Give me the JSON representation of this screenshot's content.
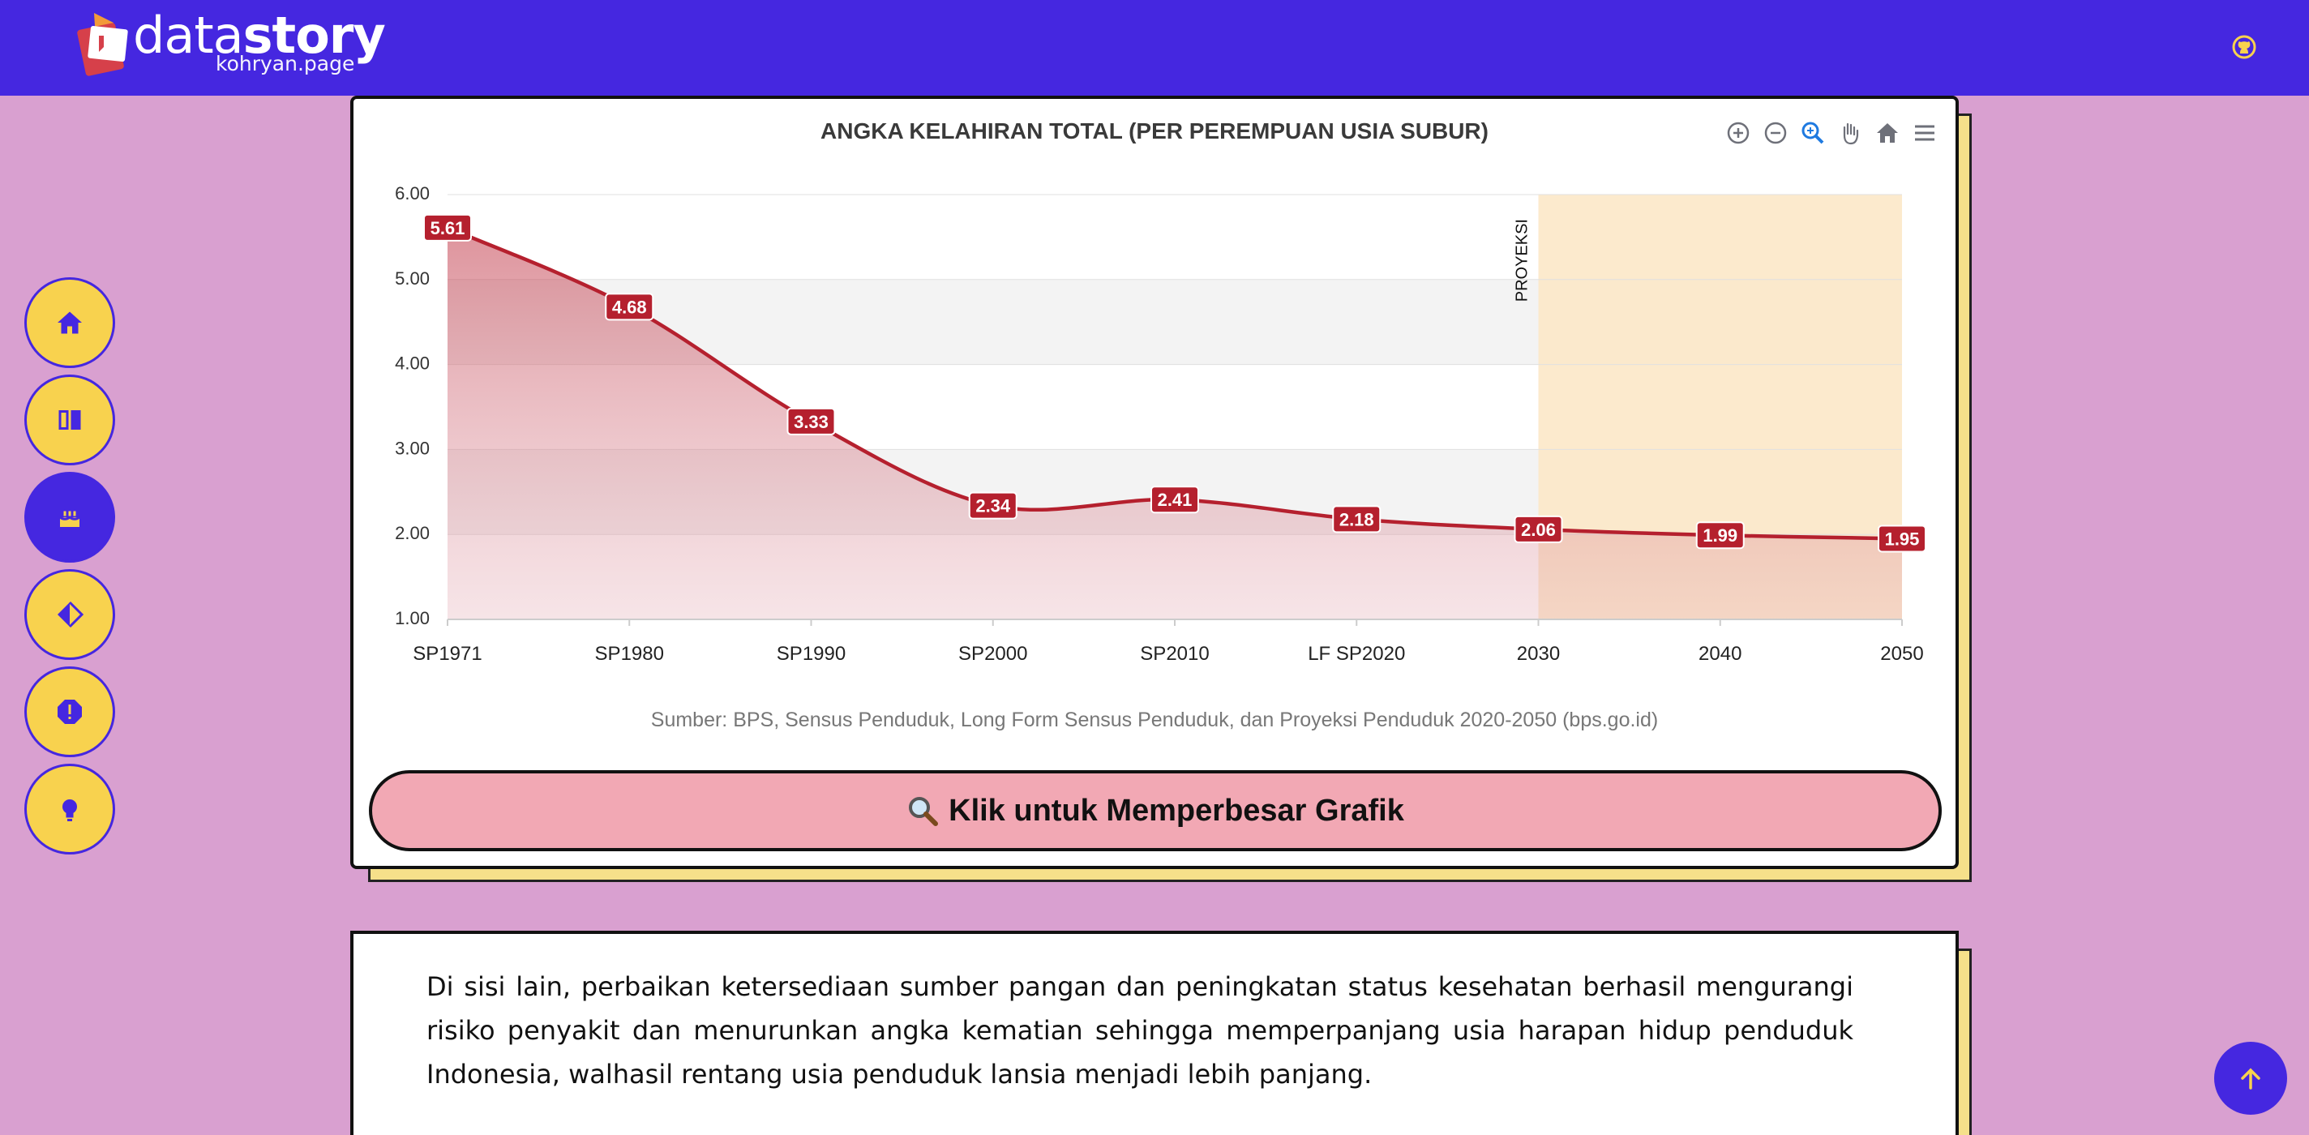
{
  "header": {
    "brand_light": "data",
    "brand_bold": "story",
    "brand_sub": "kohryan.page",
    "github_icon": "github-icon"
  },
  "side_nav": [
    {
      "icon": "home-icon",
      "active": false
    },
    {
      "icon": "book-icon",
      "active": false
    },
    {
      "icon": "birthday-cake-icon",
      "active": true
    },
    {
      "icon": "diamond-icon",
      "active": false
    },
    {
      "icon": "alert-icon",
      "active": false
    },
    {
      "icon": "lightbulb-icon",
      "active": false
    }
  ],
  "chart_card": {
    "source": "Sumber: BPS, Sensus Penduduk, Long Form Sensus Penduduk, dan Proyeksi Penduduk 2020-2050 (bps.go.id)",
    "zoom_button_label": "Klik untuk Memperbesar Grafik",
    "toolbar": [
      "zoom-in-icon",
      "zoom-out-icon",
      "selection-zoom-icon",
      "pan-icon",
      "reset-home-icon",
      "menu-icon"
    ]
  },
  "chart_data": {
    "type": "area",
    "title": "ANGKA KELAHIRAN TOTAL (PER PEREMPUAN USIA SUBUR)",
    "categories": [
      "SP1971",
      "SP1980",
      "SP1990",
      "SP2000",
      "SP2010",
      "LF SP2020",
      "2030",
      "2040",
      "2050"
    ],
    "series": [
      {
        "values": [
          5.61,
          4.68,
          3.33,
          2.34,
          2.41,
          2.18,
          2.06,
          1.99,
          1.95
        ]
      }
    ],
    "data_labels": [
      "5.61",
      "4.68",
      "3.33",
      "2.34",
      "2.41",
      "2.18",
      "2.06",
      "1.99",
      "1.95"
    ],
    "ylim": [
      1,
      6
    ],
    "yticks": [
      "1.00",
      "2.00",
      "3.00",
      "4.00",
      "5.00",
      "6.00"
    ],
    "annotation": {
      "label": "PROYEKSI",
      "from_category": "2030",
      "to_category": "2050"
    },
    "colors": {
      "line": "#b5202e",
      "label_bg": "#b5202e",
      "projection_band": "#fbe6c4"
    },
    "grid": true
  },
  "paragraph": "Di sisi lain, perbaikan ketersediaan sumber pangan dan peningkatan status kesehatan berhasil mengurangi risiko penyakit dan menurunkan angka kematian sehingga memperpanjang usia harapan hidup penduduk Indonesia, walhasil rentang usia penduduk lansia menjadi lebih panjang.",
  "colors": {
    "header": "#4527e0",
    "background": "#d9a0d0",
    "nav_button": "#f8d24e",
    "zoom_button": "#f2a8b4"
  }
}
